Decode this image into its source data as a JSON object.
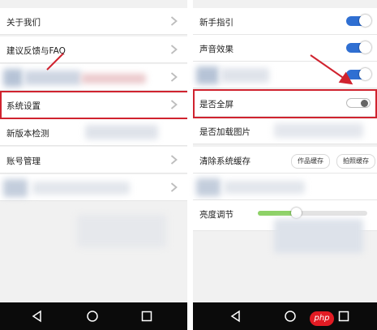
{
  "left_menu": {
    "items": [
      {
        "label": "关于我们"
      },
      {
        "label": "建议反馈与FAQ"
      },
      {
        "label": ""
      },
      {
        "label": "系统设置"
      },
      {
        "label": "新版本检测"
      },
      {
        "label": "账号管理"
      },
      {
        "label": ""
      }
    ]
  },
  "right_settings": {
    "new_user_guide": {
      "label": "新手指引",
      "toggle": "on"
    },
    "sound_effect": {
      "label": "声音效果",
      "toggle": "on"
    },
    "blurred_toggle": {
      "label": "",
      "toggle": "on"
    },
    "fullscreen": {
      "label": "是否全屏",
      "toggle": "off"
    },
    "load_images": {
      "label": "是否加载图片"
    },
    "clear_cache": {
      "label": "清除系统缓存",
      "work_cache": "作品缓存",
      "photo_cache": "拍照缓存"
    },
    "brightness": {
      "label": "亮度调节",
      "level": 0.35
    }
  },
  "watermark": {
    "text": "php"
  },
  "colors": {
    "accent": "#2f6fd2",
    "highlight_red": "#d0232f",
    "navbar": "#0b0b0b"
  }
}
